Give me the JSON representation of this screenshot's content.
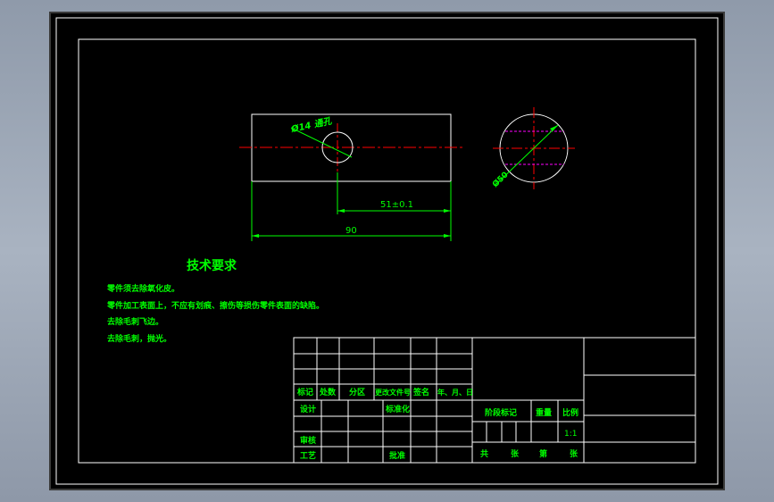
{
  "drawing": {
    "front_view": {
      "hole_label": "Ø14 通孔",
      "dim_offset": "51±0.1",
      "dim_length": "90"
    },
    "side_view": {
      "diameter_label": "Ø50"
    },
    "technical_requirements": {
      "title": "技术要求",
      "lines": [
        "零件须去除氧化皮。",
        "零件加工表面上，不应有划痕、擦伤等损伤零件表面的缺陷。",
        "去除毛刺飞边。",
        "去除毛刺，抛光。"
      ]
    },
    "title_block": {
      "rev_headers": [
        "标记",
        "处数",
        "分区",
        "更改文件号",
        "签名",
        "年、月、日"
      ],
      "design": "设计",
      "standardize": "标准化",
      "review": "审核",
      "process": "工艺",
      "approve": "批准",
      "stage_mark": "阶段标记",
      "weight": "重量",
      "scale_label": "比例",
      "scale_value": "1:1",
      "total": "共",
      "sheet": "张",
      "page": "第",
      "sheet2": "张"
    }
  },
  "colors": {
    "background": "#000000",
    "frame": "#ffffff",
    "text": "#00ff00",
    "center_line": "#ff0000",
    "hidden_line": "#ff00ff",
    "dimension": "#00ff00"
  }
}
